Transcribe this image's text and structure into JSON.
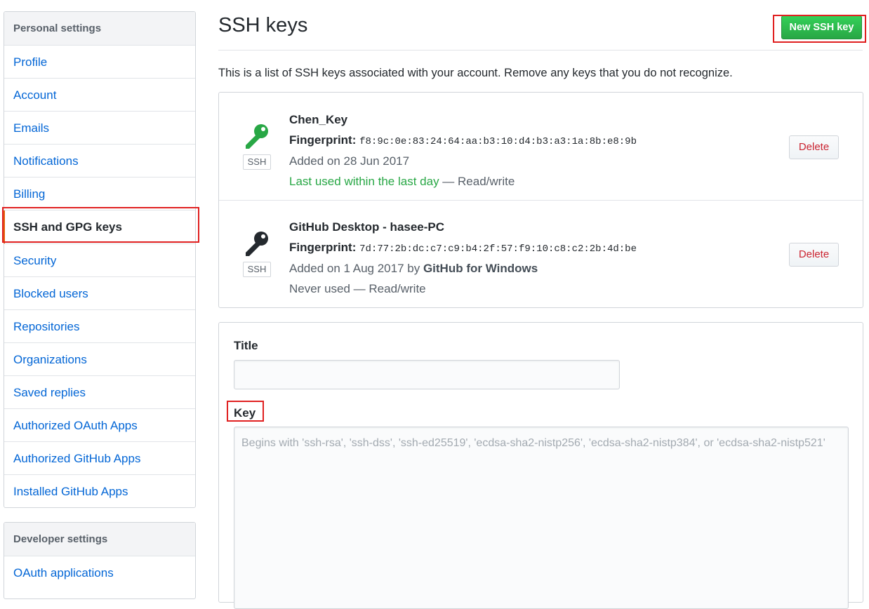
{
  "sidebar": {
    "personal_heading": "Personal settings",
    "items": [
      {
        "label": "Profile"
      },
      {
        "label": "Account"
      },
      {
        "label": "Emails"
      },
      {
        "label": "Notifications"
      },
      {
        "label": "Billing"
      },
      {
        "label": "SSH and GPG keys",
        "selected": true
      },
      {
        "label": "Security"
      },
      {
        "label": "Blocked users"
      },
      {
        "label": "Repositories"
      },
      {
        "label": "Organizations"
      },
      {
        "label": "Saved replies"
      },
      {
        "label": "Authorized OAuth Apps"
      },
      {
        "label": "Authorized GitHub Apps"
      },
      {
        "label": "Installed GitHub Apps"
      }
    ],
    "developer_heading": "Developer settings",
    "developer_items": [
      {
        "label": "OAuth applications"
      }
    ]
  },
  "main": {
    "title": "SSH keys",
    "new_key_button": "New SSH key",
    "intro": "This is a list of SSH keys associated with your account. Remove any keys that you do not recognize.",
    "keys": [
      {
        "name": "Chen_Key",
        "fingerprint_label": "Fingerprint:",
        "fingerprint": "f8:9c:0e:83:24:64:aa:b3:10:d4:b3:a3:1a:8b:e8:9b",
        "added": "Added on 28 Jun 2017",
        "last_used": "Last used within the last day",
        "access": " — Read/write",
        "badge": "SSH",
        "delete_label": "Delete",
        "icon_color": "#28a745"
      },
      {
        "name": "GitHub Desktop - hasee-PC",
        "fingerprint_label": "Fingerprint:",
        "fingerprint": "7d:77:2b:dc:c7:c9:b4:2f:57:f9:10:c8:c2:2b:4d:be",
        "added": "Added on 1 Aug 2017 by ",
        "added_by": "GitHub for Windows",
        "last_used": "Never used",
        "access": " — Read/write",
        "badge": "SSH",
        "delete_label": "Delete",
        "icon_color": "#24292e"
      }
    ],
    "form": {
      "title_label": "Title",
      "title_value": "",
      "key_label": "Key",
      "key_placeholder": "Begins with 'ssh-rsa', 'ssh-dss', 'ssh-ed25519', 'ecdsa-sha2-nistp256', 'ecdsa-sha2-nistp384', or 'ecdsa-sha2-nistp521'"
    }
  },
  "colors": {
    "link": "#0366d6",
    "primary_button": "#28a745",
    "danger": "#cb2431",
    "highlight_box": "#e02020"
  }
}
